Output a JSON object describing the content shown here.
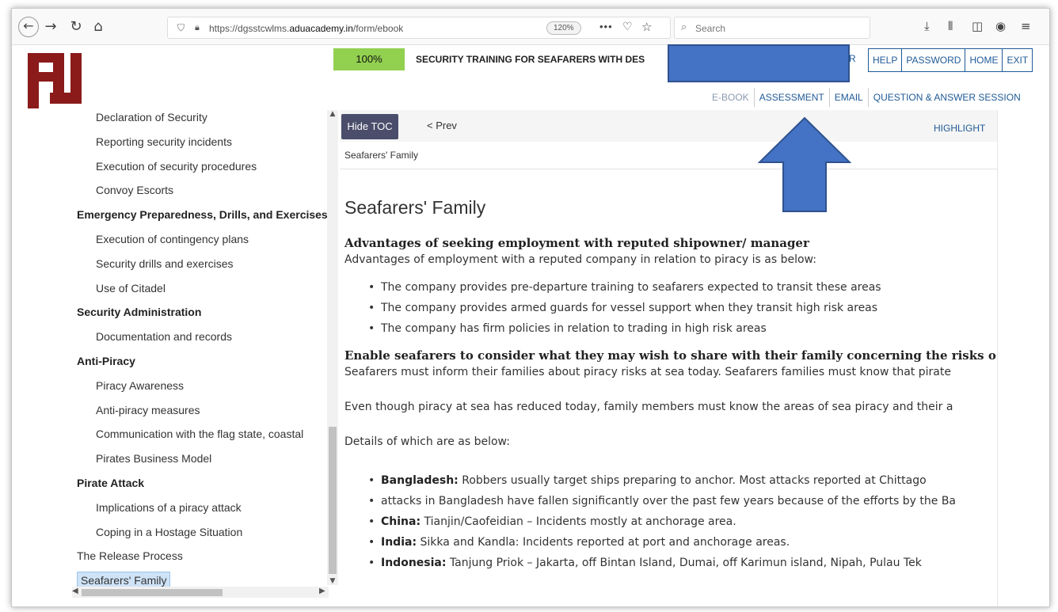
{
  "browser": {
    "url_prefix": "https://dgsstcwlms.",
    "url_domain": "aduacademy.in",
    "url_path": "/form/ebook",
    "zoom": "120%",
    "more": "•••",
    "search_placeholder": "Search"
  },
  "header": {
    "progress": "100%",
    "course_title": "SECURITY TRAINING FOR SEAFARERS WITH DES",
    "r_letter": "R",
    "top_links": [
      "HELP",
      "PASSWORD",
      "HOME",
      "EXIT"
    ],
    "sub_links": [
      "E-BOOK",
      "ASSESSMENT",
      "EMAIL",
      "QUESTION & ANSWER SESSION"
    ]
  },
  "toc": {
    "items": [
      {
        "label": "Declaration of Security",
        "kind": "sub"
      },
      {
        "label": "Reporting security incidents",
        "kind": "sub"
      },
      {
        "label": "Execution of security procedures",
        "kind": "sub"
      },
      {
        "label": "Convoy Escorts",
        "kind": "sub"
      },
      {
        "label": "Emergency Preparedness, Drills, and Exercises",
        "kind": "head"
      },
      {
        "label": "Execution of contingency plans",
        "kind": "sub"
      },
      {
        "label": "Security drills and exercises",
        "kind": "sub"
      },
      {
        "label": "Use of Citadel",
        "kind": "sub"
      },
      {
        "label": "Security Administration",
        "kind": "head"
      },
      {
        "label": "Documentation and records",
        "kind": "sub"
      },
      {
        "label": "Anti-Piracy",
        "kind": "head"
      },
      {
        "label": "Piracy Awareness",
        "kind": "sub"
      },
      {
        "label": "Anti-piracy measures",
        "kind": "sub"
      },
      {
        "label": "Communication with the flag state, coastal",
        "kind": "sub"
      },
      {
        "label": "Pirates Business Model",
        "kind": "sub"
      },
      {
        "label": "Pirate Attack",
        "kind": "head"
      },
      {
        "label": "Implications of a piracy attack",
        "kind": "sub"
      },
      {
        "label": "Coping in a Hostage Situation",
        "kind": "sub"
      },
      {
        "label": "The Release Process",
        "kind": "plain"
      },
      {
        "label": "Seafarers' Family",
        "kind": "active"
      }
    ]
  },
  "content_bar": {
    "hide_toc": "Hide TOC",
    "prev": "< Prev",
    "highlight": "HIGHLIGHT"
  },
  "breadcrumb": "Seafarers' Family",
  "article": {
    "title": "Seafarers' Family",
    "sec1_heading": "Advantages of seeking employment with reputed shipowner/ manager",
    "sec1_intro": "Advantages of employment with a reputed company in relation to piracy is as below:",
    "sec1_bullets": [
      "The company provides pre-departure training to seafarers expected to transit these areas",
      "The company provides armed guards for vessel support when they transit high risk areas",
      "The company has firm policies in relation to trading in high risk areas"
    ],
    "sec2_heading": "Enable seafarers to consider what they may wish to share with their family concerning the risks o",
    "sec2_p1": "Seafarers must inform their families about piracy risks at sea today. Seafarers families must know that pirate",
    "sec2_p2": "Even though piracy at sea has reduced today, family members must know the areas of sea piracy and their a",
    "sec2_p3": "Details of which are as below:",
    "countries": [
      {
        "name": "Bangladesh:",
        "text": "Robbers usually target ships preparing to anchor. Most attacks reported at Chittago"
      },
      {
        "name": "",
        "text": "attacks in Bangladesh have fallen significantly over the past few years because of the efforts by the Ba"
      },
      {
        "name": "China:",
        "text": "Tianjin/Caofeidian – Incidents mostly at anchorage area."
      },
      {
        "name": "India:",
        "text": "Sikka and Kandla: Incidents reported at port and anchorage areas."
      },
      {
        "name": "Indonesia:",
        "text": "Tanjung Priok – Jakarta, off Bintan Island, Dumai, off Karimun island, Nipah, Pulau Tek"
      }
    ]
  },
  "colors": {
    "progress": "#92d050",
    "link": "#1f5a96",
    "hide_toc_bg": "#4a4e6b",
    "redaction": "#4472c4",
    "arrow": "#4472c4",
    "logo": "#8b1a1a"
  }
}
